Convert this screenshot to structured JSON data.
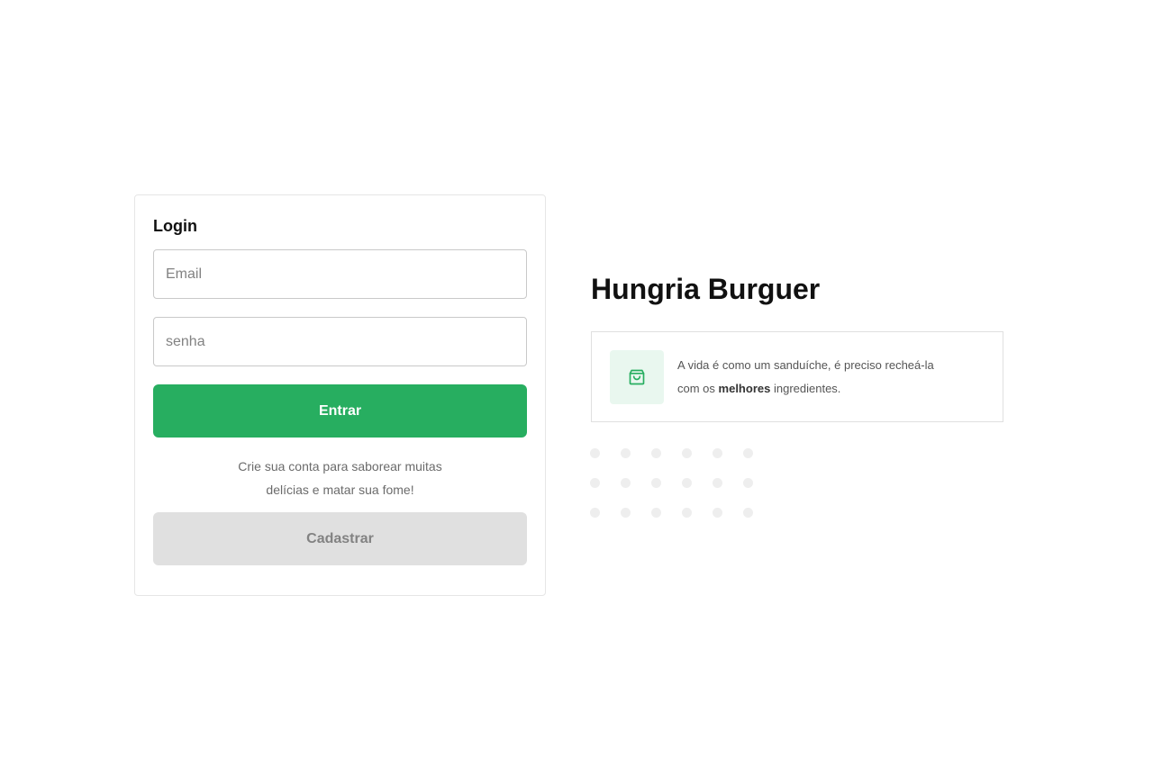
{
  "login": {
    "title": "Login",
    "email_placeholder": "Email",
    "password_placeholder": "senha",
    "submit_label": "Entrar",
    "helper_line_1": "Crie sua conta para saborear muitas",
    "helper_line_2": "delícias e matar sua fome!",
    "register_label": "Cadastrar"
  },
  "brand": {
    "title": "Hungria Burguer",
    "info_icon": "shopping-bag-icon",
    "info_text_before": "A vida é como um sanduíche, é preciso recheá-la",
    "info_text_mid": "com os",
    "info_text_bold": "melhores",
    "info_text_after": "ingredientes."
  },
  "colors": {
    "primary": "#27ae60",
    "primary_light": "#e9f7ef",
    "secondary": "#e0e0e0",
    "text_dark": "#111111",
    "text_muted": "#828282"
  }
}
